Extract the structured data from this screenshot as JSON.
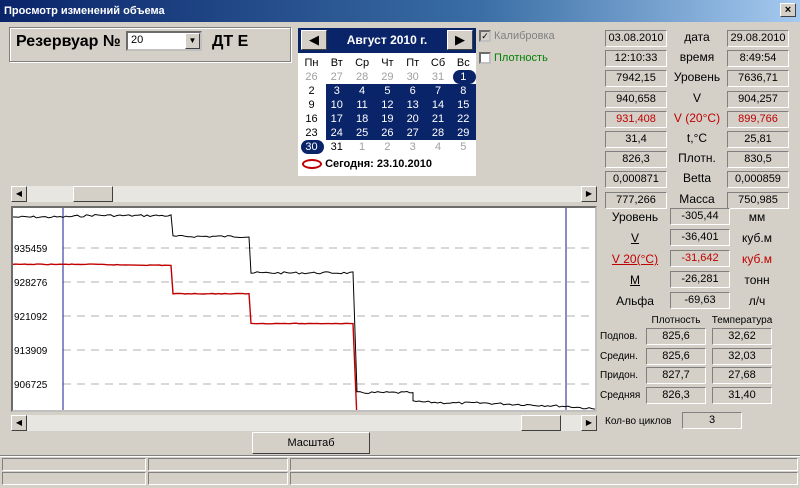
{
  "window": {
    "title": "Просмотр изменений объема",
    "close": "×"
  },
  "tank": {
    "label": "Резервуар №",
    "number": "20",
    "fuel": "ДТ Е"
  },
  "calendar": {
    "month": "Август 2010 г.",
    "prev": "◀",
    "next": "▶",
    "weekdays": [
      "Пн",
      "Вт",
      "Ср",
      "Чт",
      "Пт",
      "Сб",
      "Вс"
    ],
    "rows": [
      [
        "26",
        "27",
        "28",
        "29",
        "30",
        "31",
        "1"
      ],
      [
        "2",
        "3",
        "4",
        "5",
        "6",
        "7",
        "8"
      ],
      [
        "9",
        "10",
        "11",
        "12",
        "13",
        "14",
        "15"
      ],
      [
        "16",
        "17",
        "18",
        "19",
        "20",
        "21",
        "22"
      ],
      [
        "23",
        "24",
        "25",
        "26",
        "27",
        "28",
        "29"
      ],
      [
        "30",
        "31",
        "1",
        "2",
        "3",
        "4",
        "5"
      ]
    ],
    "today": "Сегодня: 23.10.2010"
  },
  "options": {
    "calibration": "Калибровка",
    "density": "Плотность"
  },
  "compare": {
    "rows": [
      {
        "left": "03.08.2010",
        "label": "дата",
        "right": "29.08.2010"
      },
      {
        "left": "12:10:33",
        "label": "время",
        "right": "8:49:54"
      },
      {
        "left": "7942,15",
        "label": "Уровень",
        "right": "7636,71"
      },
      {
        "left": "940,658",
        "label": "V",
        "right": "904,257"
      },
      {
        "left": "931,408",
        "label": "V (20°C)",
        "right": "899,766",
        "red": true
      },
      {
        "left": "31,4",
        "label": "t,°C",
        "right": "25,81"
      },
      {
        "left": "826,3",
        "label": "Плотн.",
        "right": "830,5"
      },
      {
        "left": "0,000871",
        "label": "Betta",
        "right": "0,000859"
      },
      {
        "left": "777,266",
        "label": "Масса",
        "right": "750,985"
      }
    ]
  },
  "diffs": [
    {
      "label": "Уровень",
      "value": "-305,44",
      "unit": "мм"
    },
    {
      "label": "V",
      "value": "-36,401",
      "unit": "куб.м"
    },
    {
      "label": "V 20(°C)",
      "value": "-31,642",
      "unit": "куб.м"
    },
    {
      "label": "M",
      "value": "-26,281",
      "unit": "тонн"
    },
    {
      "label": "Альфа",
      "value": "-69,63",
      "unit": "л/ч"
    }
  ],
  "layers": {
    "col_density": "Плотность",
    "col_temp": "Температура",
    "rows": [
      {
        "label": "Подпов.",
        "density": "825,6",
        "temp": "32,62"
      },
      {
        "label": "Средин.",
        "density": "825,6",
        "temp": "32,03"
      },
      {
        "label": "Придон.",
        "density": "827,7",
        "temp": "27,68"
      },
      {
        "label": "Средняя",
        "density": "826,3",
        "temp": "31,40"
      }
    ]
  },
  "cycles": {
    "label": "Кол-во циклов",
    "value": "3"
  },
  "scale_button": "Масштаб",
  "colors": {
    "title_bar": "#0a246a",
    "red_series": "#c00000",
    "black_series": "#000000",
    "marker": "#1a1a8c"
  },
  "chart_data": {
    "type": "line",
    "y_ticks": [
      "935459",
      "928276",
      "921092",
      "913909",
      "906725"
    ],
    "series": [
      {
        "values": [
          942000,
          942000,
          942400,
          942300,
          942300,
          937900,
          937900,
          930200,
          930200,
          904900,
          903000,
          902700,
          902700,
          902300,
          902000,
          901400
        ]
      },
      {
        "values": [
          932000,
          932000,
          932000,
          931900,
          931800,
          925800,
          925800,
          919500,
          919500,
          899100,
          899100,
          899100,
          899100,
          899100,
          899100,
          899100
        ]
      }
    ]
  }
}
